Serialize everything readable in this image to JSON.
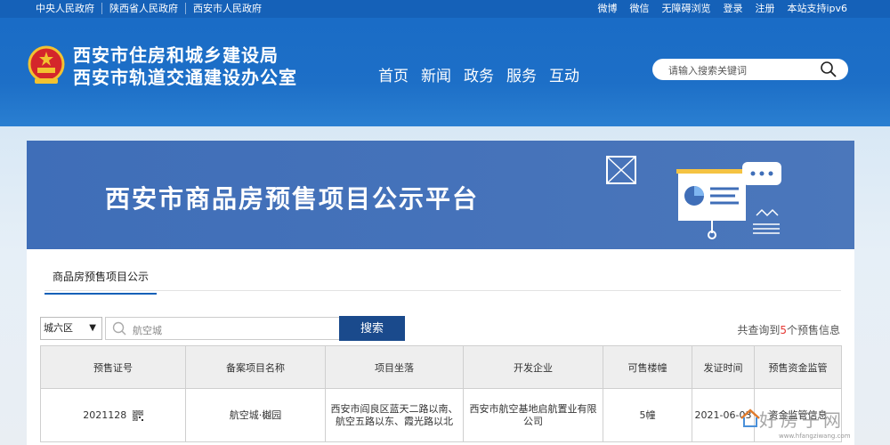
{
  "topbar": {
    "links": [
      "中央人民政府",
      "陕西省人民政府",
      "西安市人民政府"
    ],
    "right_links": [
      "微博",
      "微信",
      "无障碍浏览",
      "登录",
      "注册",
      "本站支持ipv6"
    ]
  },
  "header": {
    "org_line1": "西安市住房和城乡建设局",
    "org_line2": "西安市轨道交通建设办公室",
    "nav": [
      "首页",
      "新闻",
      "政务",
      "服务",
      "互动"
    ],
    "search_placeholder": "请输入搜索关键词"
  },
  "banner": {
    "title": "西安市商品房预售项目公示平台"
  },
  "tab": {
    "label": "商品房预售项目公示"
  },
  "filters": {
    "district": "城六区",
    "query_value": "航空城",
    "search_button": "搜索",
    "result_prefix": "共查询到",
    "result_count": "5",
    "result_suffix": "个预售信息"
  },
  "table": {
    "headers": [
      "预售证号",
      "备案项目名称",
      "项目坐落",
      "开发企业",
      "可售楼幢",
      "发证时间",
      "预售资金监管"
    ],
    "rows": [
      {
        "cert_no": "2021128",
        "project": "航空城·樾园",
        "location": "西安市阎良区蓝天二路以南、航空五路以东、霞光路以北",
        "developer": "西安市航空基地启航置业有限公司",
        "buildings": "5幢",
        "issue_date": "2021-06-03",
        "fund_supervision": "资金监管信息"
      }
    ]
  },
  "watermark": {
    "text": "好房子网",
    "url": "www.hfangziwang.com"
  },
  "colors": {
    "topbar": "#1561b8",
    "header": "#1d6fc7",
    "banner": "#4673ba",
    "search_button": "#1a4a8c",
    "count_highlight": "#e53935"
  }
}
